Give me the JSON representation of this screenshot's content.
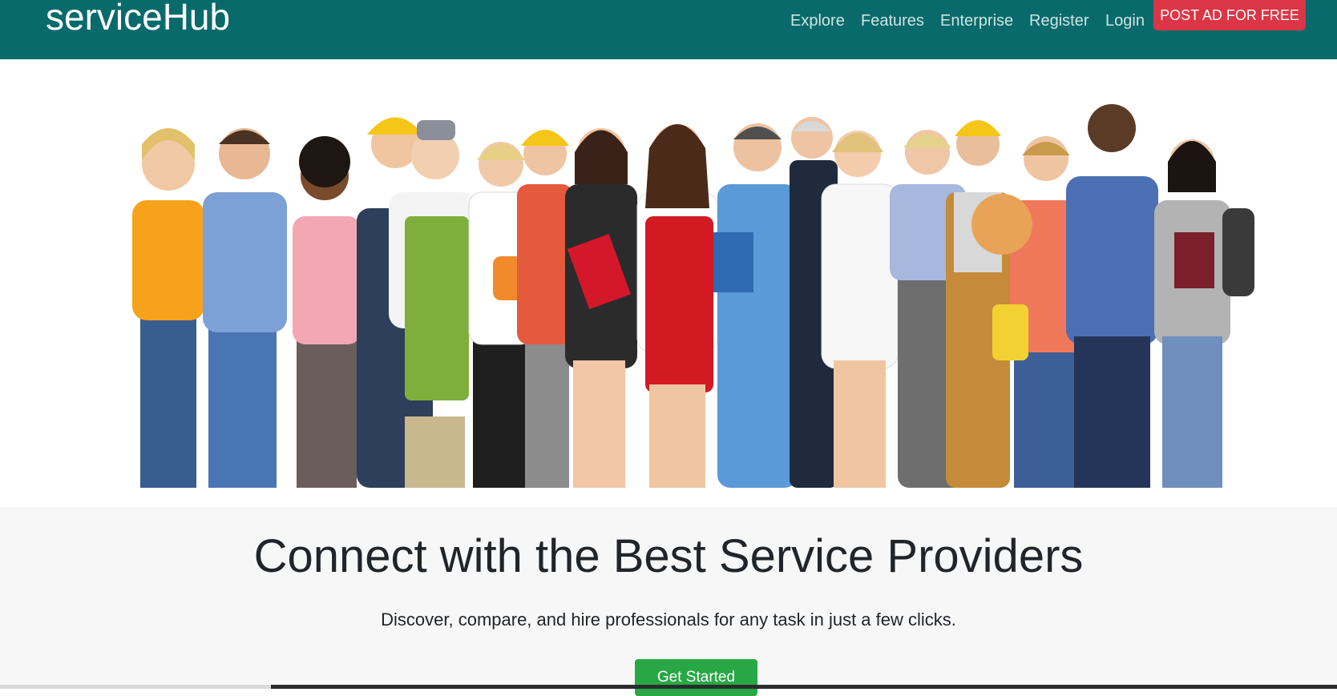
{
  "navbar": {
    "brand": "serviceHub",
    "links": [
      "Explore",
      "Features",
      "Enterprise",
      "Register",
      "Login"
    ],
    "post_ad_label": "POST AD FOR FREE",
    "background_color": "#096a6b",
    "post_ad_color": "#dc3545"
  },
  "intro": {
    "headline": "Connect with the Best Service Providers",
    "subheadline": "Discover, compare, and hire professionals for any task in just a few clicks.",
    "cta_label": "Get Started",
    "cta_color": "#28a745"
  }
}
